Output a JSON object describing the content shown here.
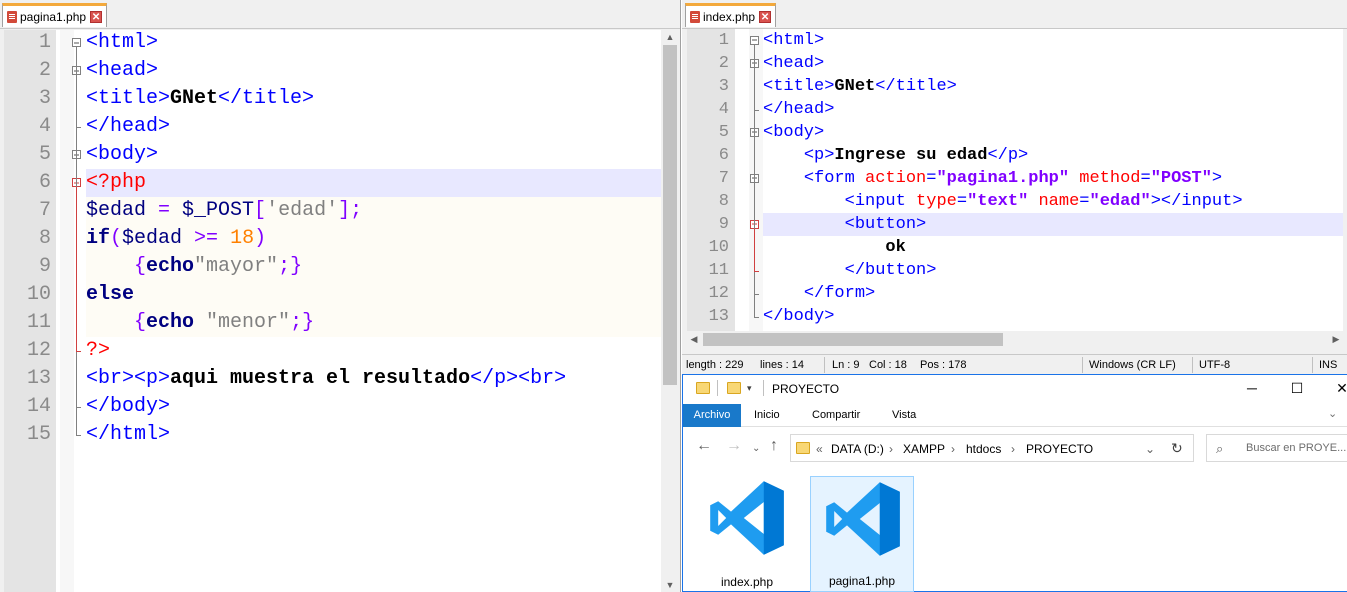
{
  "left_tab": {
    "name": "pagina1.php",
    "close": "✕"
  },
  "right_tab": {
    "name": "index.php",
    "close": "✕"
  },
  "left_code": [
    {
      "n": "1",
      "tokens": [
        [
          "tag",
          "<html>"
        ]
      ]
    },
    {
      "n": "2",
      "tokens": [
        [
          "tag",
          "<head>"
        ]
      ]
    },
    {
      "n": "3",
      "tokens": [
        [
          "tag",
          "<title>"
        ],
        [
          "txt",
          "GNet"
        ],
        [
          "tag",
          "</title>"
        ]
      ]
    },
    {
      "n": "4",
      "tokens": [
        [
          "tag",
          "</head>"
        ]
      ]
    },
    {
      "n": "5",
      "tokens": [
        [
          "tag",
          "<body>"
        ]
      ]
    },
    {
      "n": "6",
      "tokens": [
        [
          "phptag",
          "<?php"
        ]
      ]
    },
    {
      "n": "7",
      "tokens": [
        [
          "var",
          "$edad "
        ],
        [
          "op",
          "= "
        ],
        [
          "var",
          "$_POST"
        ],
        [
          "op",
          "["
        ],
        [
          "str",
          "'edad'"
        ],
        [
          "op",
          "];"
        ]
      ]
    },
    {
      "n": "8",
      "tokens": [
        [
          "kw",
          "if"
        ],
        [
          "op",
          "("
        ],
        [
          "var",
          "$edad "
        ],
        [
          "op",
          ">= "
        ],
        [
          "num",
          "18"
        ],
        [
          "op",
          ")"
        ]
      ]
    },
    {
      "n": "9",
      "tokens": [
        [
          "plain",
          "    "
        ],
        [
          "brace",
          "{"
        ],
        [
          "kw",
          "echo"
        ],
        [
          "str",
          "\"mayor\""
        ],
        [
          "op",
          ";}"
        ]
      ]
    },
    {
      "n": "10",
      "tokens": [
        [
          "kw",
          "else"
        ]
      ]
    },
    {
      "n": "11",
      "tokens": [
        [
          "plain",
          "    "
        ],
        [
          "brace",
          "{"
        ],
        [
          "kw",
          "echo "
        ],
        [
          "str",
          "\"menor\""
        ],
        [
          "op",
          ";}"
        ]
      ]
    },
    {
      "n": "12",
      "tokens": [
        [
          "phptag",
          "?>"
        ]
      ]
    },
    {
      "n": "13",
      "tokens": [
        [
          "tag",
          "<br><p>"
        ],
        [
          "txt",
          "aqui muestra el resultado"
        ],
        [
          "tag",
          "</p><br>"
        ]
      ]
    },
    {
      "n": "14",
      "tokens": [
        [
          "tag",
          "</body>"
        ]
      ]
    },
    {
      "n": "15",
      "tokens": [
        [
          "tag",
          "</html>"
        ]
      ]
    }
  ],
  "right_code": [
    {
      "n": "1",
      "tokens": [
        [
          "tag",
          "<html>"
        ]
      ]
    },
    {
      "n": "2",
      "tokens": [
        [
          "tag",
          "<head>"
        ]
      ]
    },
    {
      "n": "3",
      "tokens": [
        [
          "tag",
          "<title>"
        ],
        [
          "txt",
          "GNet"
        ],
        [
          "tag",
          "</title>"
        ]
      ]
    },
    {
      "n": "4",
      "tokens": [
        [
          "tag",
          "</head>"
        ]
      ]
    },
    {
      "n": "5",
      "tokens": [
        [
          "tag",
          "<body>"
        ]
      ]
    },
    {
      "n": "6",
      "tokens": [
        [
          "plain",
          "    "
        ],
        [
          "tag",
          "<p>"
        ],
        [
          "txt",
          "Ingrese su edad"
        ],
        [
          "tag",
          "</p>"
        ]
      ]
    },
    {
      "n": "7",
      "tokens": [
        [
          "plain",
          "    "
        ],
        [
          "tag",
          "<form "
        ],
        [
          "attr",
          "action"
        ],
        [
          "tag",
          "="
        ],
        [
          "val",
          "\"pagina1.php\""
        ],
        [
          "attr",
          " method"
        ],
        [
          "tag",
          "="
        ],
        [
          "val",
          "\"POST\""
        ],
        [
          "tag",
          ">"
        ]
      ]
    },
    {
      "n": "8",
      "tokens": [
        [
          "plain",
          "        "
        ],
        [
          "tag",
          "<input "
        ],
        [
          "attr",
          "type"
        ],
        [
          "tag",
          "="
        ],
        [
          "val",
          "\"text\""
        ],
        [
          "attr",
          " name"
        ],
        [
          "tag",
          "="
        ],
        [
          "val",
          "\"edad\""
        ],
        [
          "tag",
          "></input>"
        ]
      ]
    },
    {
      "n": "9",
      "tokens": [
        [
          "plain",
          "        "
        ],
        [
          "tag",
          "<button>"
        ]
      ]
    },
    {
      "n": "10",
      "tokens": [
        [
          "plain",
          "            "
        ],
        [
          "txt",
          "ok"
        ]
      ]
    },
    {
      "n": "11",
      "tokens": [
        [
          "plain",
          "        "
        ],
        [
          "tag",
          "</button>"
        ]
      ]
    },
    {
      "n": "12",
      "tokens": [
        [
          "plain",
          "    "
        ],
        [
          "tag",
          "</form>"
        ]
      ]
    },
    {
      "n": "13",
      "tokens": [
        [
          "tag",
          "</body>"
        ]
      ]
    }
  ],
  "statusbar": {
    "length": "length : 229",
    "lines": "lines : 14",
    "ln": "Ln : 9",
    "col": "Col : 18",
    "pos": "Pos : 178",
    "eol": "Windows (CR LF)",
    "encoding": "UTF-8",
    "mode": "INS"
  },
  "explorer": {
    "title": "PROYECTO",
    "ribbon": {
      "file": "Archivo",
      "home": "Inicio",
      "share": "Compartir",
      "view": "Vista"
    },
    "breadcrumb": {
      "chev": "«",
      "drive": "DATA (D:)",
      "sep": "›",
      "p1": "XAMPP",
      "p2": "htdocs",
      "p3": "PROYECTO"
    },
    "search_placeholder": "Buscar en PROYE...",
    "files": [
      {
        "name": "index.php"
      },
      {
        "name": "pagina1.php"
      }
    ]
  },
  "colors": {
    "vscode_blue": "#0078d4",
    "vscode_light": "#1f9cf0",
    "accent": "#1979ca"
  }
}
